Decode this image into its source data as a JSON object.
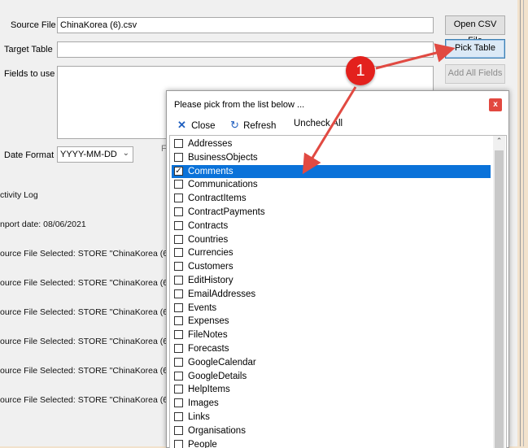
{
  "form": {
    "source_file_label": "Source File",
    "source_file_value": "ChinaKorea (6).csv",
    "target_table_label": "Target Table",
    "target_table_value": "",
    "fields_label": "Fields to use",
    "date_format_label": "Date Format",
    "date_format_value": "YYYY-MM-DD",
    "fields_overlap_text": "F"
  },
  "buttons": {
    "open_csv": "Open CSV File",
    "pick_table": "Pick Table",
    "add_all_fields": "Add All Fields"
  },
  "log": {
    "lines": [
      "ctivity Log",
      "nport date: 08/06/2021",
      "ource File Selected: STORE \"ChinaKorea (6).c",
      "ource File Selected: STORE \"ChinaKorea (6).c",
      "ource File Selected: STORE \"ChinaKorea (6).c",
      "ource File Selected: STORE \"ChinaKorea (6).c",
      "ource File Selected: STORE \"ChinaKorea (6).c",
      "ource File Selected: STORE \"ChinaKorea (6).c"
    ]
  },
  "dialog": {
    "title": "Please pick from the list below ...",
    "close_x": "x",
    "toolbar": {
      "close": "Close",
      "refresh": "Refresh",
      "uncheck_all": "Uncheck All"
    },
    "items": [
      {
        "label": "Addresses",
        "checked": false,
        "selected": false
      },
      {
        "label": "BusinessObjects",
        "checked": false,
        "selected": false
      },
      {
        "label": "Comments",
        "checked": true,
        "selected": true
      },
      {
        "label": "Communications",
        "checked": false,
        "selected": false
      },
      {
        "label": "ContractItems",
        "checked": false,
        "selected": false
      },
      {
        "label": "ContractPayments",
        "checked": false,
        "selected": false
      },
      {
        "label": "Contracts",
        "checked": false,
        "selected": false
      },
      {
        "label": "Countries",
        "checked": false,
        "selected": false
      },
      {
        "label": "Currencies",
        "checked": false,
        "selected": false
      },
      {
        "label": "Customers",
        "checked": false,
        "selected": false
      },
      {
        "label": "EditHistory",
        "checked": false,
        "selected": false
      },
      {
        "label": "EmailAddresses",
        "checked": false,
        "selected": false
      },
      {
        "label": "Events",
        "checked": false,
        "selected": false
      },
      {
        "label": "Expenses",
        "checked": false,
        "selected": false
      },
      {
        "label": "FileNotes",
        "checked": false,
        "selected": false
      },
      {
        "label": "Forecasts",
        "checked": false,
        "selected": false
      },
      {
        "label": "GoogleCalendar",
        "checked": false,
        "selected": false
      },
      {
        "label": "GoogleDetails",
        "checked": false,
        "selected": false
      },
      {
        "label": "HelpItems",
        "checked": false,
        "selected": false
      },
      {
        "label": "Images",
        "checked": false,
        "selected": false
      },
      {
        "label": "Links",
        "checked": false,
        "selected": false
      },
      {
        "label": "Organisations",
        "checked": false,
        "selected": false
      },
      {
        "label": "People",
        "checked": false,
        "selected": false
      }
    ]
  },
  "annotation": {
    "badge_number": "1",
    "badge_color": "#e3211d",
    "arrow_color": "#e14a42"
  },
  "colors": {
    "selection": "#0a72d9",
    "highlight_button": "#dbe9f6"
  }
}
